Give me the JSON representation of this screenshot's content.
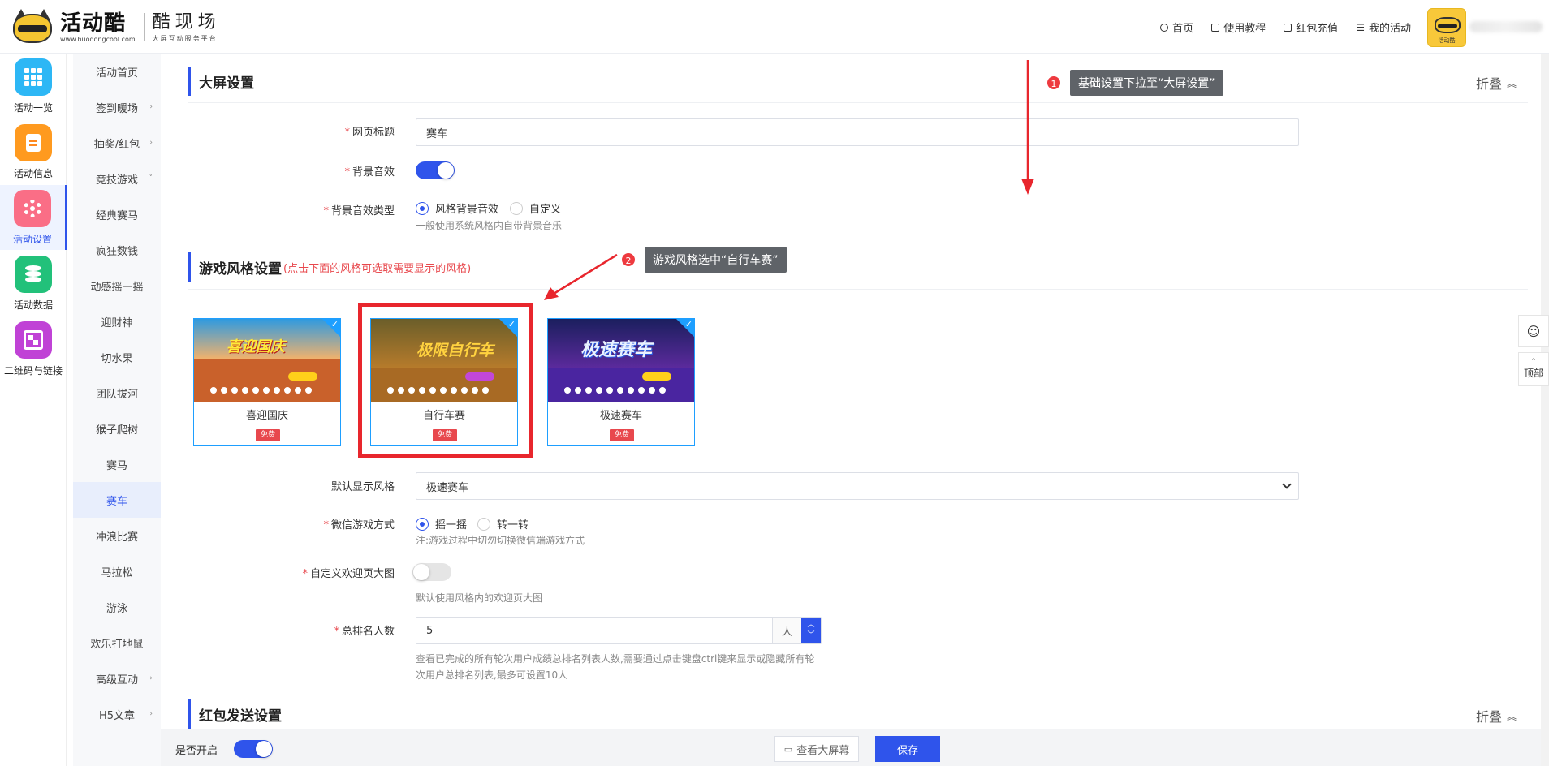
{
  "header": {
    "logo_name": "活动酷",
    "logo_url": "www.huodongcool.com",
    "logo_slogan": "酷现场",
    "logo_sub": "大屏互动服务平台",
    "nav": [
      {
        "label": "首页",
        "icon": "home-icon"
      },
      {
        "label": "使用教程",
        "icon": "book-icon"
      },
      {
        "label": "红包充值",
        "icon": "wallet-icon"
      },
      {
        "label": "我的活动",
        "icon": "list-icon"
      }
    ],
    "avatar_text": "活动酷"
  },
  "rail": [
    {
      "label": "活动一览",
      "color": "#2db7f5",
      "icon": "grid-icon"
    },
    {
      "label": "活动信息",
      "color": "#ff9a1f",
      "icon": "document-icon"
    },
    {
      "label": "活动设置",
      "color": "#fa6e86",
      "icon": "gear-icon",
      "active": true
    },
    {
      "label": "活动数据",
      "color": "#22c17a",
      "icon": "database-icon"
    },
    {
      "label": "二维码与链接",
      "color": "#c042d6",
      "icon": "qrcode-icon"
    }
  ],
  "submenu": [
    {
      "label": "活动首页",
      "chev": ""
    },
    {
      "label": "签到暖场",
      "chev": "›"
    },
    {
      "label": "抽奖/红包",
      "chev": "›"
    },
    {
      "label": "竞技游戏",
      "chev": "˅"
    },
    {
      "label": "经典赛马",
      "chev": ""
    },
    {
      "label": "疯狂数钱",
      "chev": ""
    },
    {
      "label": "动感摇一摇",
      "chev": ""
    },
    {
      "label": "迎财神",
      "chev": ""
    },
    {
      "label": "切水果",
      "chev": ""
    },
    {
      "label": "团队拔河",
      "chev": ""
    },
    {
      "label": "猴子爬树",
      "chev": ""
    },
    {
      "label": "赛马",
      "chev": ""
    },
    {
      "label": "赛车",
      "chev": "",
      "active": true
    },
    {
      "label": "冲浪比赛",
      "chev": ""
    },
    {
      "label": "马拉松",
      "chev": ""
    },
    {
      "label": "游泳",
      "chev": ""
    },
    {
      "label": "欢乐打地鼠",
      "chev": ""
    },
    {
      "label": "高级互动",
      "chev": "›"
    },
    {
      "label": "H5文章",
      "chev": "›"
    }
  ],
  "screen_settings": {
    "title": "大屏设置",
    "collapse_label": "折叠",
    "page_title_label": "网页标题",
    "page_title_value": "赛车",
    "bg_sound_label": "背景音效",
    "bg_sound_on": true,
    "bg_sound_type_label": "背景音效类型",
    "bg_sound_options": [
      "风格背景音效",
      "自定义"
    ],
    "bg_sound_selected": "风格背景音效",
    "bg_sound_help": "一般使用系统风格内自带背景音乐"
  },
  "game_style": {
    "title": "游戏风格设置",
    "hint": "(点击下面的风格可选取需要显示的风格)",
    "styles": [
      {
        "name": "喜迎国庆",
        "badge": "免费",
        "thumb_text": "喜迎国庆"
      },
      {
        "name": "自行车赛",
        "badge": "免费",
        "thumb_text": "极限自行车"
      },
      {
        "name": "极速赛车",
        "badge": "免费",
        "thumb_text": "极速赛车"
      }
    ],
    "default_style_label": "默认显示风格",
    "default_style_value": "极速赛车",
    "wechat_mode_label": "微信游戏方式",
    "wechat_mode_options": [
      "摇一摇",
      "转一转"
    ],
    "wechat_mode_selected": "摇一摇",
    "wechat_mode_help": "注:游戏过程中切勿切换微信端游戏方式",
    "custom_welcome_label": "自定义欢迎页大图",
    "custom_welcome_on": false,
    "custom_welcome_help": "默认使用风格内的欢迎页大图",
    "rank_label": "总排名人数",
    "rank_value": "5",
    "rank_unit": "人",
    "rank_help_1": "查看已完成的所有轮次用户成绩总排名列表人数,需要通过点击键盘ctrl键来显示或隐藏所有轮",
    "rank_help_2": "次用户总排名列表,最多可设置10人"
  },
  "redpacket": {
    "title": "红包发送设置",
    "collapse_label": "折叠"
  },
  "annotations": [
    {
      "num": "1",
      "text": "基础设置下拉至“大屏设置”"
    },
    {
      "num": "2",
      "text": "游戏风格选中“自行车赛”"
    }
  ],
  "bottom": {
    "enable_label": "是否开启",
    "enable_on": true,
    "view_screen_label": "查看大屏幕",
    "save_label": "保存"
  },
  "float": {
    "top_label": "顶部",
    "top_arrow": "⌃"
  }
}
